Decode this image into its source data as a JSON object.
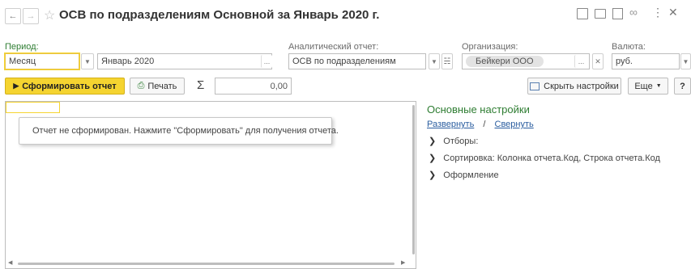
{
  "window": {
    "title": "ОСВ по подразделениям Основной за Январь 2020 г.",
    "icons": [
      "back-arrow-icon",
      "forward-arrow-icon",
      "star-icon",
      "save-icon",
      "print-icon",
      "preview-icon",
      "link-icon",
      "more-icon",
      "close-icon"
    ]
  },
  "filters": {
    "period_label": "Период:",
    "period_value": "Месяц",
    "period_date": "Январь 2020",
    "analytic_label": "Аналитический отчет:",
    "analytic_value": "ОСВ по подразделениям",
    "org_label": "Организация:",
    "org_value": "Бейкери ООО",
    "currency_label": "Валюта:",
    "currency_value": "руб."
  },
  "toolbar": {
    "generate_label": "Сформировать отчет",
    "print_label": "Печать",
    "sum_symbol": "Σ",
    "sum_value": "0,00",
    "hide_settings_label": "Скрыть настройки",
    "more_label": "Еще",
    "help_label": "?"
  },
  "report": {
    "message": "Отчет не сформирован. Нажмите \"Сформировать\" для получения отчета."
  },
  "settings": {
    "title": "Основные настройки",
    "expand_label": "Развернуть",
    "separator": "/",
    "collapse_label": "Свернуть",
    "items": [
      {
        "label": "Отборы:"
      },
      {
        "label": "Сортировка: Колонка отчета.Код, Строка отчета.Код"
      },
      {
        "label": "Оформление"
      }
    ]
  },
  "colors": {
    "accent_yellow": "#f5d430",
    "label_green": "#2e7d32",
    "link_blue": "#2a5d9f"
  }
}
